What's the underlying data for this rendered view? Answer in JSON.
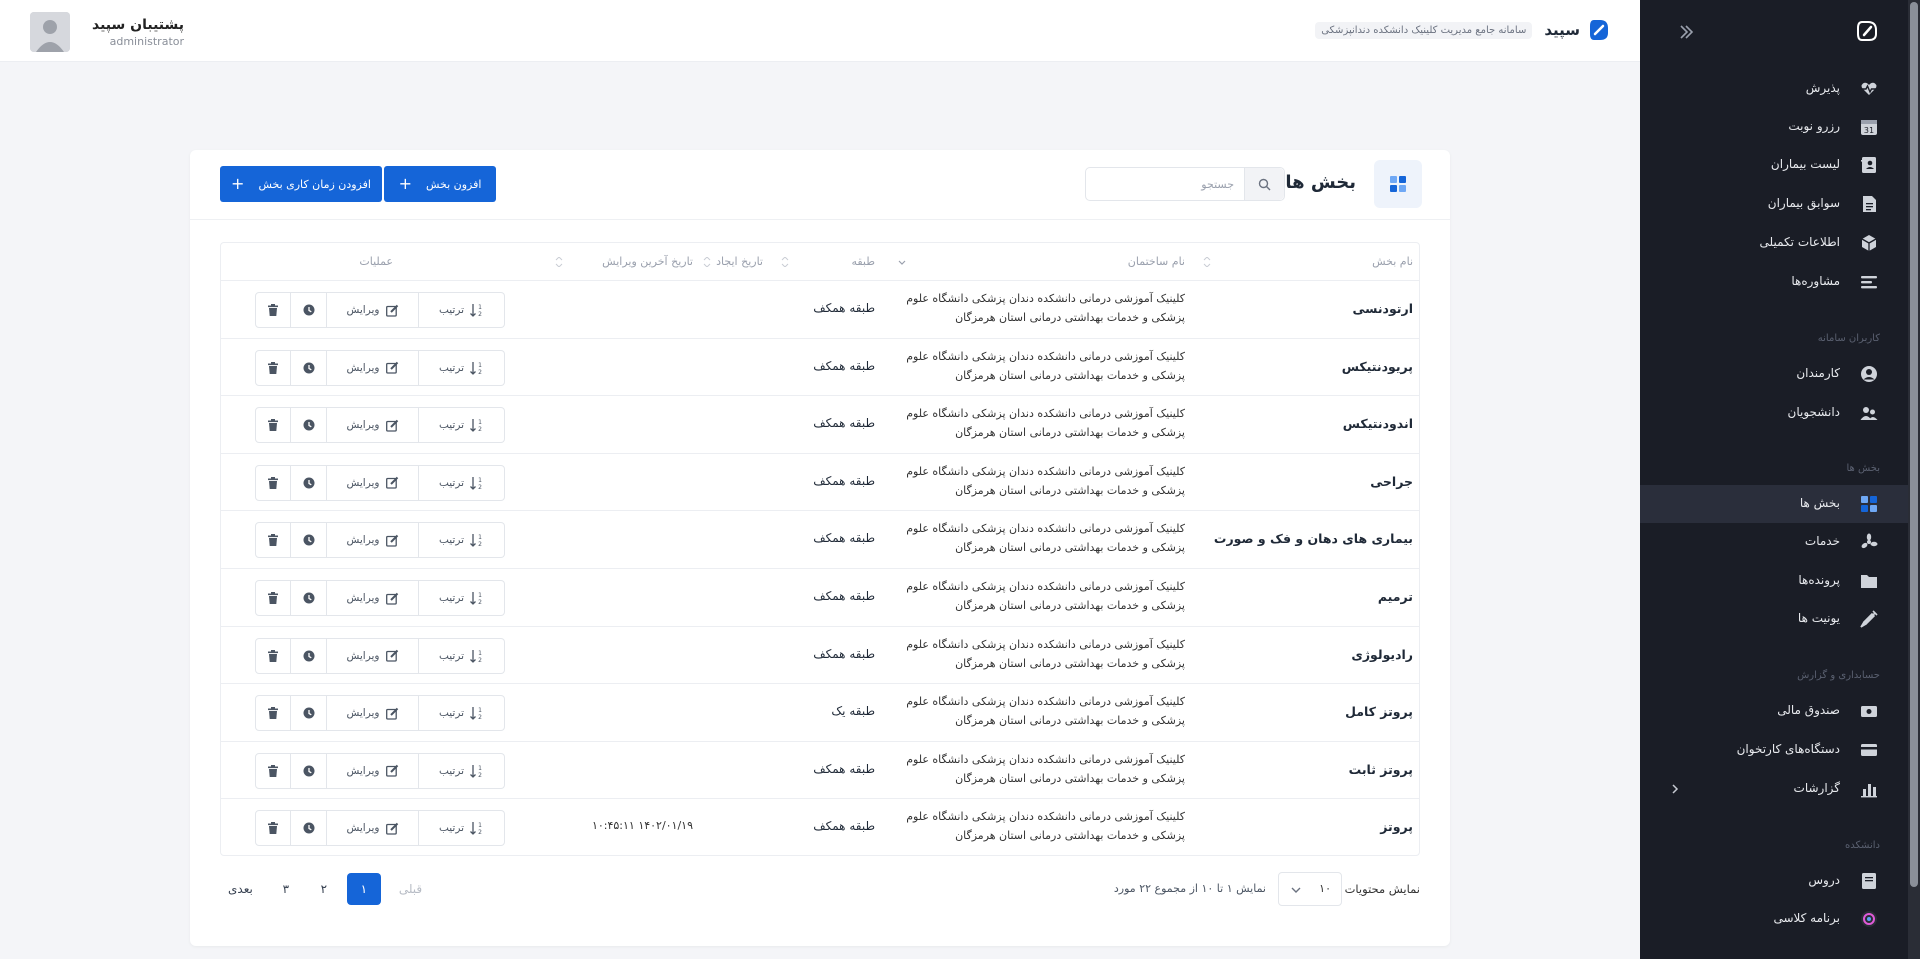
{
  "brand": {
    "name": "سپید",
    "subtitle": "سامانه جامع مدیریت کلینیک دانشکده دندانپزشکی"
  },
  "user": {
    "name": "پشتیبان سپید",
    "role": "administrator"
  },
  "sidebar": {
    "items": [
      {
        "label": "پذیرش",
        "icon": "heart-pulse-icon"
      },
      {
        "label": "رزرو نوبت",
        "icon": "calendar-31-icon"
      },
      {
        "label": "لیست بیماران",
        "icon": "address-book-icon"
      },
      {
        "label": "سوابق بیماران",
        "icon": "file-document-icon"
      },
      {
        "label": "اطلاعات تکمیلی",
        "icon": "cube-icon"
      },
      {
        "label": "مشاوره‌ها",
        "icon": "align-lines-icon"
      },
      {
        "label": "کارمندان",
        "icon": "user-circle-icon"
      },
      {
        "label": "دانشجویان",
        "icon": "users-icon"
      },
      {
        "label": "بخش ها",
        "icon": "grid-squares-icon"
      },
      {
        "label": "خدمات",
        "icon": "fan-icon"
      },
      {
        "label": "پرونده‌ها",
        "icon": "folder-icon"
      },
      {
        "label": "یونیت ها",
        "icon": "syringe-icon"
      },
      {
        "label": "صندوق مالی",
        "icon": "cash-register-icon"
      },
      {
        "label": "دستگاه‌های کارتخوان",
        "icon": "credit-card-icon"
      },
      {
        "label": "گزارشات",
        "icon": "bar-chart-icon"
      },
      {
        "label": "دروس",
        "icon": "book-icon"
      },
      {
        "label": "برنامه کلاسی",
        "icon": "schedule-icon"
      }
    ],
    "sections": {
      "users": "کاربران سامانه",
      "departments": "بخش ها",
      "accounting": "حسابداری و گزارش",
      "faculty": "دانشکده"
    }
  },
  "page": {
    "title": "بخش ها",
    "search_placeholder": "جستجو",
    "add_button": "افزون بخش",
    "add_time_button": "افزودن زمان کاری بخش"
  },
  "table": {
    "headers": {
      "name": "نام بخش",
      "building": "نام ساختمان",
      "floor": "طبقه",
      "created": "تاریخ ایجاد",
      "updated": "تاریخ آخرین ویرایش",
      "actions": "عملیات"
    },
    "actions": {
      "order": "ترتیب",
      "edit": "ویرایش"
    },
    "rows": [
      {
        "name": "ارتودنسی",
        "building": "کلینیک آموزشی درمانی دانشکده دندان پزشکی دانشگاه علوم پزشکی و خدمات بهداشتی درمانی استان هرمزگان",
        "floor": "طبقه همکف",
        "created": "",
        "updated": ""
      },
      {
        "name": "پریودنتیکس",
        "building": "کلینیک آموزشی درمانی دانشکده دندان پزشکی دانشگاه علوم پزشکی و خدمات بهداشتی درمانی استان هرمزگان",
        "floor": "طبقه همکف",
        "created": "",
        "updated": ""
      },
      {
        "name": "اندودنتیکس",
        "building": "کلینیک آموزشی درمانی دانشکده دندان پزشکی دانشگاه علوم پزشکی و خدمات بهداشتی درمانی استان هرمزگان",
        "floor": "طبقه همکف",
        "created": "",
        "updated": ""
      },
      {
        "name": "جراحی",
        "building": "کلینیک آموزشی درمانی دانشکده دندان پزشکی دانشگاه علوم پزشکی و خدمات بهداشتی درمانی استان هرمزگان",
        "floor": "طبقه همکف",
        "created": "",
        "updated": ""
      },
      {
        "name": "بیماری های دهان و فک و صورت",
        "building": "کلینیک آموزشی درمانی دانشکده دندان پزشکی دانشگاه علوم پزشکی و خدمات بهداشتی درمانی استان هرمزگان",
        "floor": "طبقه همکف",
        "created": "",
        "updated": ""
      },
      {
        "name": "ترمیم",
        "building": "کلینیک آموزشی درمانی دانشکده دندان پزشکی دانشگاه علوم پزشکی و خدمات بهداشتی درمانی استان هرمزگان",
        "floor": "طبقه همکف",
        "created": "",
        "updated": ""
      },
      {
        "name": "رادیولوژی",
        "building": "کلینیک آموزشی درمانی دانشکده دندان پزشکی دانشگاه علوم پزشکی و خدمات بهداشتی درمانی استان هرمزگان",
        "floor": "طبقه همکف",
        "created": "",
        "updated": ""
      },
      {
        "name": "پروتز کامل",
        "building": "کلینیک آموزشی درمانی دانشکده دندان پزشکی دانشگاه علوم پزشکی و خدمات بهداشتی درمانی استان هرمزگان",
        "floor": "طبقه یک",
        "created": "",
        "updated": ""
      },
      {
        "name": "پروتز ثابت",
        "building": "کلینیک آموزشی درمانی دانشکده دندان پزشکی دانشگاه علوم پزشکی و خدمات بهداشتی درمانی استان هرمزگان",
        "floor": "طبقه همکف",
        "created": "",
        "updated": ""
      },
      {
        "name": "پروتز",
        "building": "کلینیک آموزشی درمانی دانشکده دندان پزشکی دانشگاه علوم پزشکی و خدمات بهداشتی درمانی استان هرمزگان",
        "floor": "طبقه همکف",
        "created": "",
        "updated": "۱۴۰۲/۰۱/۱۹ ۱۰:۴۵:۱۱"
      }
    ]
  },
  "footer": {
    "per_page_label": "نمایش محتویات",
    "per_page_value": "۱۰",
    "info": "نمایش ۱ تا ۱۰ از مجموع ۲۲ مورد",
    "pagination": {
      "prev": "قبلی",
      "pages": [
        "۱",
        "۲",
        "۳"
      ],
      "next": "بعدی",
      "current": "۱"
    }
  },
  "colors": {
    "primary": "#1565d8",
    "sidebar_bg": "#1a1d26",
    "sidebar_active": "#2a2e3b",
    "page_bg": "#f4f5f8"
  }
}
